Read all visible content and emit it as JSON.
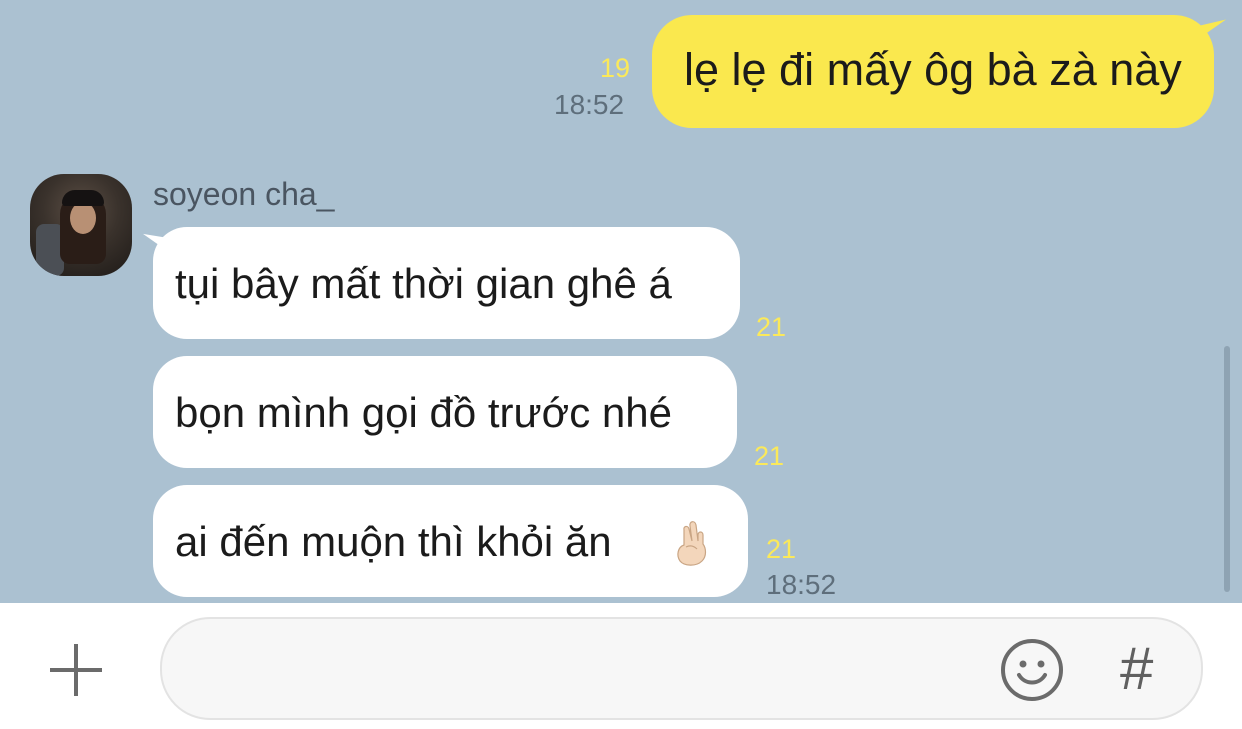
{
  "outgoing": {
    "text": "lẹ lẹ đi mấy ôg bà zà này",
    "unread": "19",
    "time": "18:52"
  },
  "incoming": {
    "sender": "soyeon cha_",
    "messages": [
      {
        "text": "tụi bây mất thời gian ghê á",
        "unread": "21"
      },
      {
        "text": "bọn mình gọi đồ trước nhé",
        "unread": "21"
      },
      {
        "text": "ai đến muộn thì khỏi ăn",
        "unread": "21",
        "time": "18:52",
        "emoji": "crossed-fingers"
      }
    ]
  },
  "input": {
    "value": "",
    "icons": [
      "plus-icon",
      "emoji-icon",
      "hashtag-icon"
    ],
    "hash_label": "#"
  },
  "colors": {
    "chat_background": "#abc1d1",
    "outgoing_bubble": "#fae84e",
    "incoming_bubble": "#ffffff",
    "unread_count": "#fbe95a"
  }
}
